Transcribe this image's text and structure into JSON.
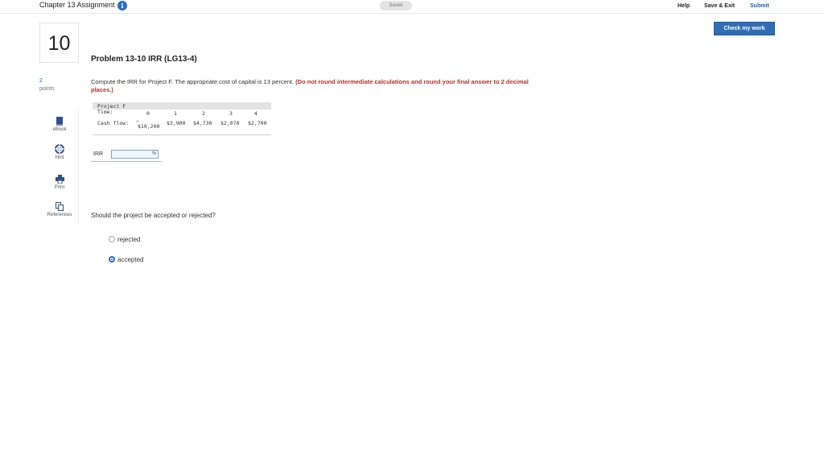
{
  "header": {
    "assignment_title": "Chapter 13 Assignment",
    "info_glyph": "i",
    "saved_status": "Saved",
    "help": "Help",
    "save_exit": "Save & Exit",
    "submit": "Submit",
    "check_work": "Check my work"
  },
  "question": {
    "number": "10",
    "points_value": "2",
    "points_label": "points"
  },
  "tools": [
    {
      "label": "eBook",
      "icon": "book-icon"
    },
    {
      "label": "Hint",
      "icon": "lifebuoy-icon"
    },
    {
      "label": "Print",
      "icon": "printer-icon"
    },
    {
      "label": "References",
      "icon": "copy-icon"
    }
  ],
  "problem": {
    "title": "Problem 13-10 IRR (LG13-4)",
    "prompt": "Compute the IRR for Project F. The appropriate cost of capital is 13 percent.",
    "instruction": "(Do not round intermediate calculations and round your final answer to 2 decimal places.)"
  },
  "table": {
    "project": "Project F",
    "time_label": "Time:",
    "times": [
      "0",
      "1",
      "2",
      "3",
      "4"
    ],
    "flow_label": "Cash flow:",
    "minus_sign": "–",
    "flows": [
      "$10,200",
      "$3,900",
      "$4,730",
      "$2,070",
      "$2,700"
    ]
  },
  "irr": {
    "label": "IRR",
    "value": "",
    "unit": "%"
  },
  "decision": {
    "question": "Should the project be accepted or rejected?",
    "options": [
      {
        "label": "rejected",
        "selected": false
      },
      {
        "label": "accepted",
        "selected": true
      }
    ]
  },
  "colors": {
    "accent": "#2f6db5",
    "warning_text": "#b7312b"
  }
}
